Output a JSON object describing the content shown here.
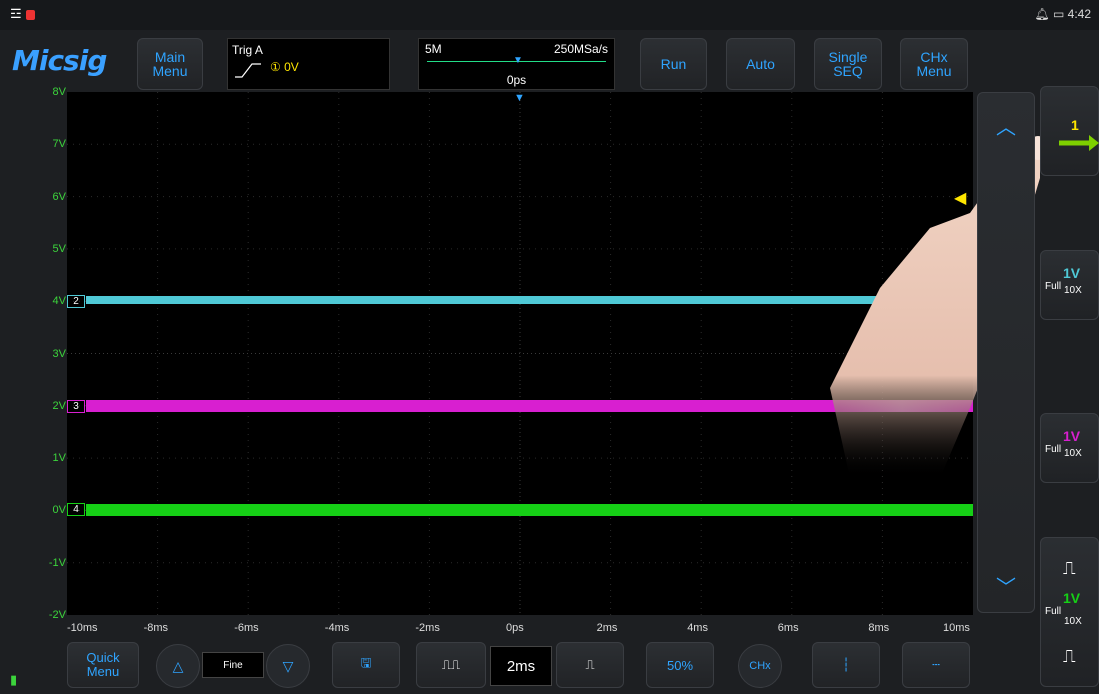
{
  "status_bar": {
    "time": "4:42",
    "icons": [
      "wifi-icon",
      "battery-alert-icon",
      "mute-icon",
      "battery-icon"
    ]
  },
  "brand": {
    "logo": "Micsig"
  },
  "top_buttons": {
    "main_menu": "Main\nMenu",
    "run": "Run",
    "auto": "Auto",
    "single_seq": "Single\nSEQ",
    "chx_menu": "CHx\nMenu"
  },
  "trigger": {
    "label": "Trig A",
    "level": "① 0V"
  },
  "timebase": {
    "memory": "5M",
    "sample_rate": "250MSa/s",
    "position": "0ps"
  },
  "y_axis_labels": [
    "8V",
    "7V",
    "6V",
    "5V",
    "4V",
    "3V",
    "2V",
    "1V",
    "0V",
    "-1V",
    "-2V"
  ],
  "x_axis_labels": [
    "-10ms",
    "-8ms",
    "-6ms",
    "-4ms",
    "-2ms",
    "0ps",
    "2ms",
    "4ms",
    "6ms",
    "8ms",
    "10ms"
  ],
  "channels": [
    {
      "id": "2",
      "offset_label": "4V",
      "color": "#4fc9d6"
    },
    {
      "id": "3",
      "offset_label": "2V",
      "color": "#d81fd0"
    },
    {
      "id": "4",
      "offset_label": "0V",
      "color": "#16d016"
    }
  ],
  "channel_boxes": [
    {
      "coupling": "Full",
      "scale": "1V",
      "probe": "10X",
      "color": "#4fc9d6"
    },
    {
      "coupling": "Full",
      "scale": "1V",
      "probe": "10X",
      "color": "#d81fd0"
    },
    {
      "coupling": "Full",
      "scale": "1V",
      "probe": "10X",
      "color": "#16d016"
    }
  ],
  "channel1_marker": "1",
  "bottom": {
    "quick_menu": "Quick\nMenu",
    "fine": "Fine",
    "time_per_div": "2ms",
    "percent": "50%",
    "chx": "CHx"
  },
  "colors": {
    "accent": "#2fa4ff",
    "trigger": "#ffe600",
    "axis": "#3cd43c"
  }
}
